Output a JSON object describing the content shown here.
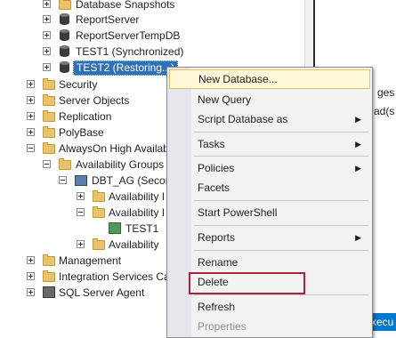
{
  "tree": {
    "items": [
      {
        "label": "Database Snapshots",
        "icon": "folder-icon",
        "toggle": "plus"
      },
      {
        "label": "ReportServer",
        "icon": "database-icon",
        "toggle": "plus"
      },
      {
        "label": "ReportServerTempDB",
        "icon": "database-icon",
        "toggle": "plus"
      },
      {
        "label": "TEST1 (Synchronized)",
        "icon": "database-icon",
        "toggle": "plus"
      },
      {
        "label": "TEST2 (Restoring...)",
        "icon": "database-icon",
        "toggle": "plus",
        "selected": true
      },
      {
        "label": "Security",
        "icon": "folder-icon",
        "toggle": "plus"
      },
      {
        "label": "Server Objects",
        "icon": "folder-icon",
        "toggle": "plus"
      },
      {
        "label": "Replication",
        "icon": "folder-icon",
        "toggle": "plus"
      },
      {
        "label": "PolyBase",
        "icon": "folder-icon",
        "toggle": "plus"
      },
      {
        "label": "AlwaysOn High Availab",
        "icon": "folder-icon",
        "toggle": "minus"
      },
      {
        "label": "Availability Groups",
        "icon": "folder-icon",
        "toggle": "minus"
      },
      {
        "label": "DBT_AG (Secon",
        "icon": "availability-group-icon",
        "toggle": "minus"
      },
      {
        "label": "Availability I",
        "icon": "folder-icon",
        "toggle": "plus"
      },
      {
        "label": "Availability I",
        "icon": "folder-icon",
        "toggle": "minus"
      },
      {
        "label": "TEST1",
        "icon": "availability-database-icon",
        "toggle": "none"
      },
      {
        "label": "Availability",
        "icon": "folder-icon",
        "toggle": "plus"
      },
      {
        "label": "Management",
        "icon": "folder-icon",
        "toggle": "plus"
      },
      {
        "label": "Integration Services Ca",
        "icon": "folder-icon",
        "toggle": "plus"
      },
      {
        "label": "SQL Server Agent",
        "icon": "sql-agent-icon",
        "toggle": "plus"
      }
    ]
  },
  "background": {
    "frag_ages": "ges",
    "frag_code": "ad(s",
    "status_text": "xecu"
  },
  "context_menu": {
    "items": [
      {
        "label": "New Database...",
        "highlighted": true,
        "submenu": false
      },
      {
        "label": "New Query",
        "submenu": false
      },
      {
        "label": "Script Database as",
        "submenu": true
      },
      {
        "label": "Tasks",
        "submenu": true
      },
      {
        "label": "Policies",
        "submenu": true
      },
      {
        "label": "Facets",
        "submenu": false
      },
      {
        "label": "Start PowerShell",
        "submenu": false
      },
      {
        "label": "Reports",
        "submenu": true
      },
      {
        "label": "Rename",
        "submenu": false
      },
      {
        "label": "Delete",
        "submenu": false,
        "annotated": true
      },
      {
        "label": "Refresh",
        "submenu": false
      },
      {
        "label": "Properties",
        "submenu": false,
        "disabled": true
      }
    ],
    "submenu_arrow": "▶",
    "highlight_color": "#fff8d8",
    "annotation_color": "#a7233a"
  }
}
